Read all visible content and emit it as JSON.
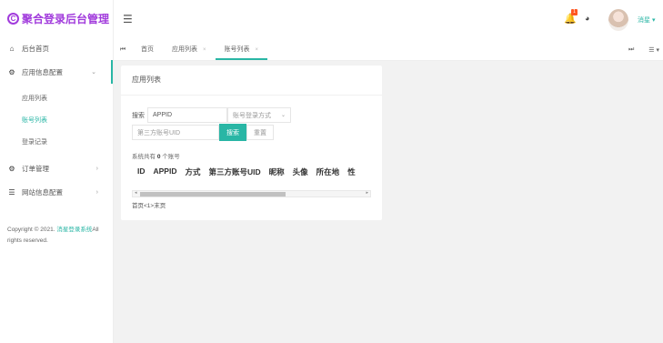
{
  "brand": {
    "logo_glyph": "C",
    "title": "聚合登录后台管理"
  },
  "sidebar": {
    "items": [
      {
        "label": "后台首页",
        "icon": "home-icon",
        "glyph": "⌂"
      },
      {
        "label": "应用信息配置",
        "icon": "settings-icon",
        "glyph": "⚙",
        "chevron": "⌄",
        "children": [
          "应用列表",
          "账号列表",
          "登录记录"
        ]
      },
      {
        "label": "订单管理",
        "icon": "order-icon",
        "glyph": "⚙",
        "chevron": "›"
      },
      {
        "label": "网站信息配置",
        "icon": "list-icon",
        "glyph": "☰",
        "chevron": "›"
      }
    ],
    "copyright_prefix": "Copyright © 2021.",
    "copyright_link": "消星登录系统",
    "copyright_suffix": "All rights reserved."
  },
  "header": {
    "menu_glyph": "☰",
    "bell_glyph": "🔔",
    "badge": "1",
    "palette_glyph": "◕",
    "username": "消星 ▾"
  },
  "tabs": {
    "left_arrow": "⏮",
    "items": [
      {
        "label": "首页"
      },
      {
        "label": "应用列表",
        "close": "×"
      },
      {
        "label": "账号列表",
        "close": "×"
      }
    ],
    "right_arrow": "⏭",
    "menu": "☰ ▾"
  },
  "card": {
    "title": "应用列表",
    "search_label": "搜索",
    "appid_value": "APPID",
    "login_method_placeholder": "账号登录方式",
    "uid_placeholder": "第三方账号UID",
    "search_button": "搜索",
    "reset_button": "重置",
    "count_text_prefix": "系统共有",
    "count_value": "0",
    "count_text_suffix": "个账号",
    "columns": [
      "ID",
      "APPID",
      "方式",
      "第三方账号UID",
      "昵称",
      "头像",
      "所在地",
      "性"
    ],
    "pager": "首页<1>末页"
  },
  "colors": {
    "accent": "#29b6a5",
    "brand": "#a13bdc",
    "badge": "#ff5722"
  }
}
